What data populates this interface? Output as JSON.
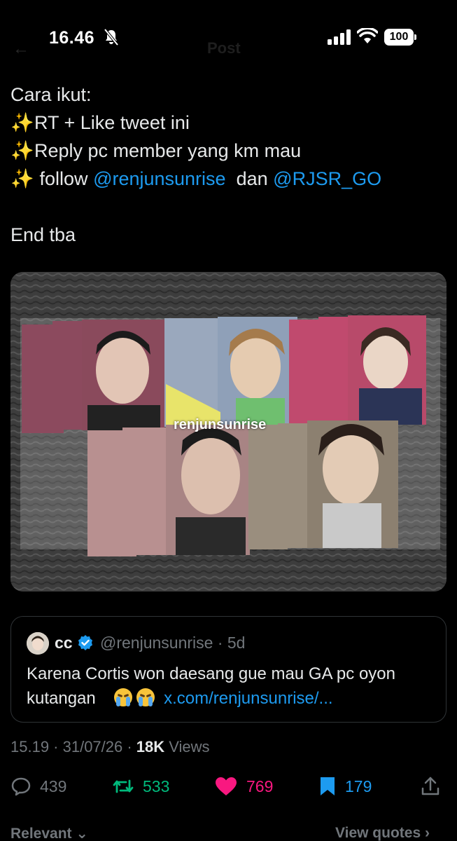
{
  "status_bar": {
    "time": "16.46",
    "battery": "100",
    "ghost_back": "←",
    "ghost_title": "Post"
  },
  "tweet": {
    "lines": {
      "l1": "Cara ikut:",
      "l2": "RT + Like tweet ini",
      "l3": "Reply pc member yang km mau",
      "l4_prefix": "follow",
      "l4_mention1": "@renjunsunrise",
      "l4_mid": "dan",
      "l4_mention2": "@RJSR_GO",
      "l5": "End tba"
    },
    "sparkle_emoji": "✨",
    "photo_watermark": "renjunsunrise"
  },
  "quote": {
    "name": "cc",
    "handle_time": "@renjunsunrise · 5d",
    "text_line1": "Karena Cortis won daesang gue mau GA pc oyon",
    "text_line2_prefix": "kutangan",
    "link": "x.com/renjunsunrise/..."
  },
  "meta": {
    "time_date": "15.19 · 31/07/26 · ",
    "views_count": "18K",
    "views_label": " Views"
  },
  "actions": {
    "replies": "439",
    "reposts": "533",
    "likes": "769",
    "bookmarks": "179"
  },
  "bottom": {
    "sort_label": "Relevant ⌄",
    "view_quotes": "View quotes ›"
  },
  "colors": {
    "background": "#000000",
    "text": "#e7e9ea",
    "muted": "#71767b",
    "link": "#1d9bf0",
    "repost": "#00ba7c",
    "like": "#f91880"
  }
}
